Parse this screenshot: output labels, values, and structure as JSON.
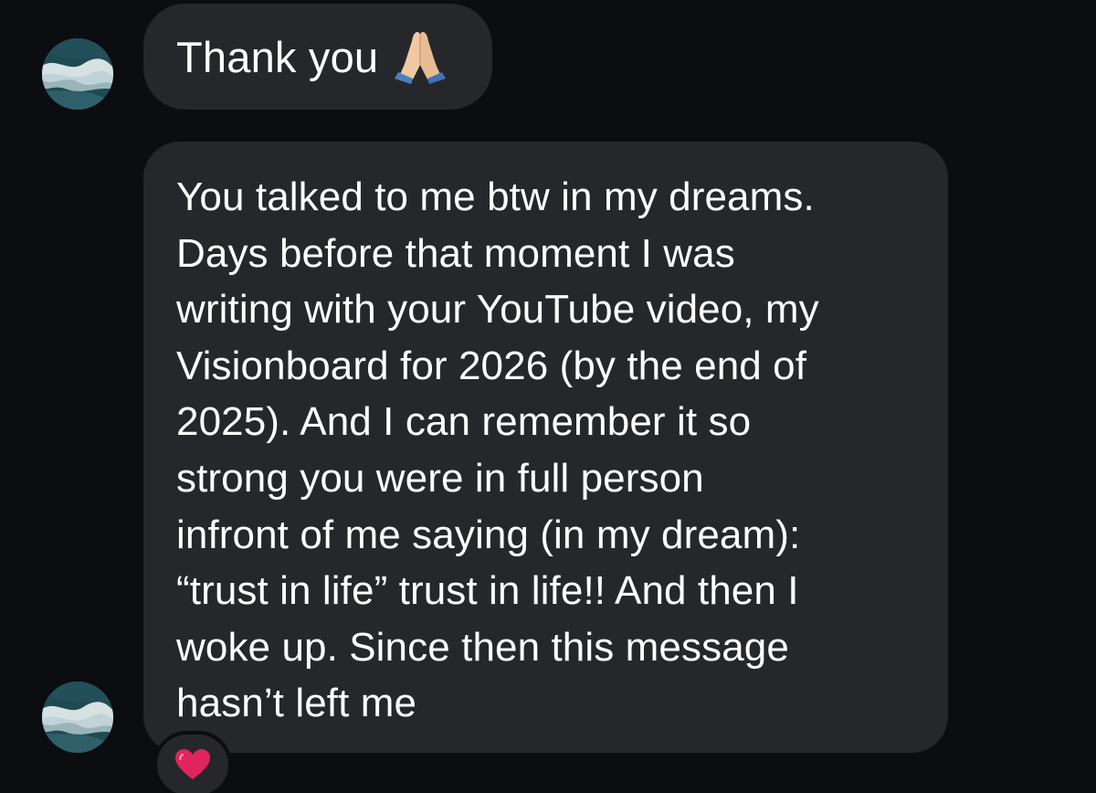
{
  "messages": [
    {
      "text": "Thank you",
      "emoji": "folded-hands"
    },
    {
      "text": "You talked to me btw in my dreams.\nDays before that moment I was\nwriting with your YouTube video, my\nVisionboard for 2026 (by the end of\n2025). And I can remember it so\nstrong you were in full person\ninfront of me saying (in my dream):\n“trust in life” trust in life!! And then I\nwoke up. Since then this message\nhasn’t left me",
      "reaction": "red-heart"
    }
  ],
  "colors": {
    "background": "#0c0d10",
    "bubble": "#26272b",
    "text": "#ffffff",
    "heart": "#e0245e"
  }
}
